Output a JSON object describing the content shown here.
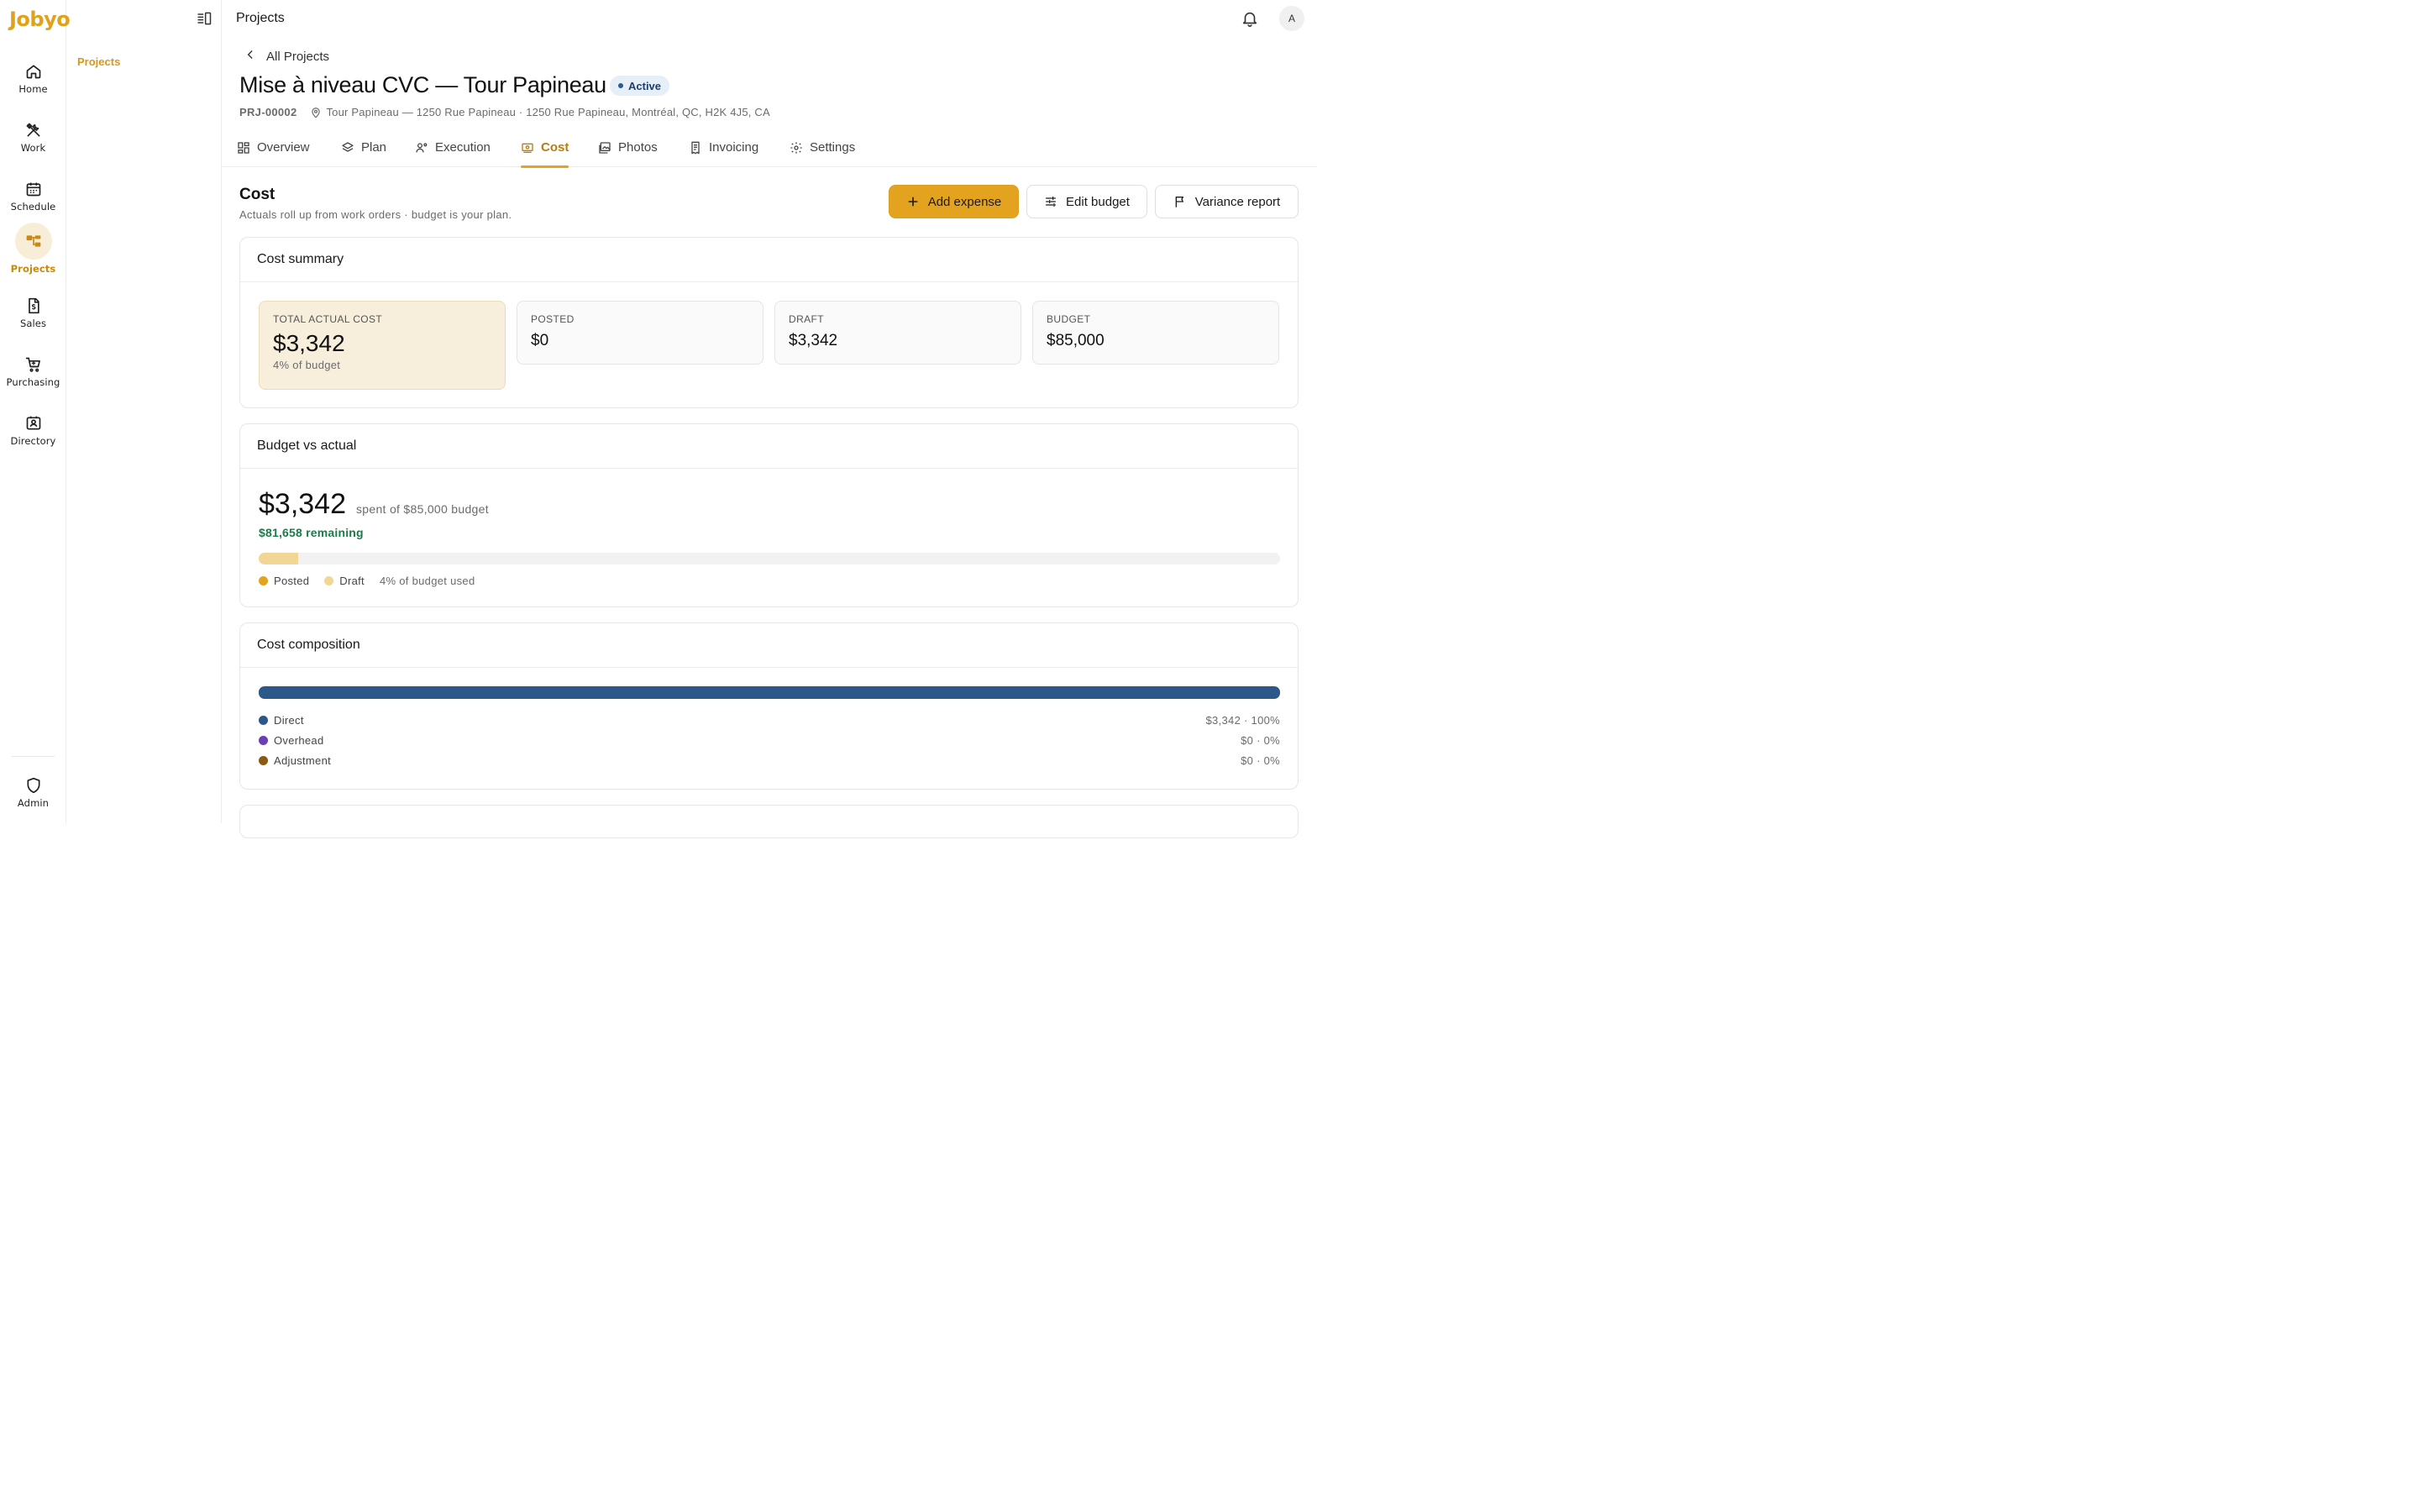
{
  "app": {
    "brand": "Jobyo"
  },
  "rail": {
    "items": [
      {
        "label": "Home",
        "icon": "home-icon"
      },
      {
        "label": "Work",
        "icon": "tools-icon"
      },
      {
        "label": "Schedule",
        "icon": "calendar-icon"
      },
      {
        "label": "Projects",
        "icon": "projects-icon",
        "active": true
      },
      {
        "label": "Sales",
        "icon": "invoice-dollar-icon"
      },
      {
        "label": "Purchasing",
        "icon": "cart-icon"
      },
      {
        "label": "Directory",
        "icon": "contact-card-icon"
      }
    ],
    "admin": "Admin"
  },
  "subnav": {
    "link": "Projects"
  },
  "topbar": {
    "title": "Projects",
    "avatar": "A"
  },
  "header": {
    "back": "All Projects",
    "title": "Mise à niveau CVC — Tour Papineau",
    "status": "Active",
    "code": "PRJ-00002",
    "address": "Tour Papineau — 1250 Rue Papineau · 1250 Rue Papineau, Montréal, QC, H2K 4J5, CA"
  },
  "tabs": [
    {
      "label": "Overview",
      "icon": "grid-icon"
    },
    {
      "label": "Plan",
      "icon": "layers-icon"
    },
    {
      "label": "Execution",
      "icon": "user-gear-icon"
    },
    {
      "label": "Cost",
      "icon": "cash-icon",
      "active": true
    },
    {
      "label": "Photos",
      "icon": "photos-icon"
    },
    {
      "label": "Invoicing",
      "icon": "receipt-icon"
    },
    {
      "label": "Settings",
      "icon": "gear-icon"
    }
  ],
  "cost": {
    "title": "Cost",
    "subtitle": "Actuals roll up from work orders · budget is your plan.",
    "buttons": {
      "add": "Add expense",
      "edit": "Edit budget",
      "variance": "Variance report"
    }
  },
  "summary": {
    "title": "Cost summary",
    "total_label": "TOTAL ACTUAL COST",
    "total_value": "$3,342",
    "total_sub": "4% of budget",
    "posted_label": "POSTED",
    "posted_value": "$0",
    "draft_label": "DRAFT",
    "draft_value": "$3,342",
    "budget_label": "BUDGET",
    "budget_value": "$85,000"
  },
  "bva": {
    "title": "Budget vs actual",
    "amount": "$3,342",
    "of_text": "spent of $85,000 budget",
    "remaining": "$81,658 remaining",
    "posted_fraction": 0.0,
    "draft_fraction": 0.039,
    "legend_posted": "Posted",
    "legend_draft": "Draft",
    "used_text": "4% of budget used",
    "colors": {
      "posted": "#e4a31e",
      "draft": "#f1d696"
    }
  },
  "composition": {
    "title": "Cost composition",
    "rows": [
      {
        "label": "Direct",
        "value": "$3,342 · 100%",
        "fraction": 1.0,
        "color": "#2b5789"
      },
      {
        "label": "Overhead",
        "value": "$0 · 0%",
        "fraction": 0.0,
        "color": "#6a3fb3"
      },
      {
        "label": "Adjustment",
        "value": "$0 · 0%",
        "fraction": 0.0,
        "color": "#8a5a12"
      }
    ]
  }
}
